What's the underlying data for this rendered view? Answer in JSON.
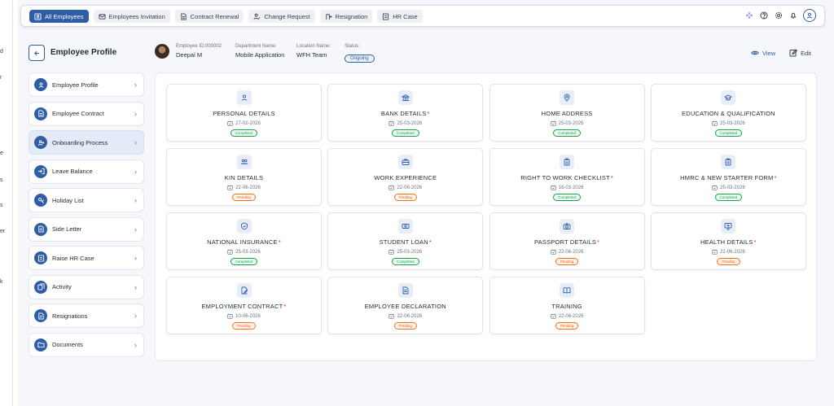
{
  "tabs": [
    {
      "label": "All Employees",
      "icon": "user-card-icon",
      "active": true
    },
    {
      "label": "Employees Invitation",
      "icon": "mail-icon",
      "active": false
    },
    {
      "label": "Contract Renewal",
      "icon": "document-icon",
      "active": false
    },
    {
      "label": "Change Request",
      "icon": "user-edit-icon",
      "active": false
    },
    {
      "label": "Resignation",
      "icon": "resign-icon",
      "active": false
    },
    {
      "label": "HR Case",
      "icon": "case-icon",
      "active": false
    }
  ],
  "edge_letters": [
    "d",
    "r",
    "e",
    "s",
    "s",
    "er",
    "k"
  ],
  "header": {
    "title": "Employee Profile",
    "employee_id_label": "Employee ID:000002",
    "employee_name": "Deepal M",
    "department_label": "Department Name:",
    "department_value": "Mobile Application",
    "location_label": "Location Name:",
    "location_value": "WFH Team",
    "status_label": "Status:",
    "status_value": "Ongoing",
    "view_label": "View",
    "edit_label": "Edit"
  },
  "menu": [
    {
      "label": "Employee Profile",
      "icon": "user-icon",
      "active": false
    },
    {
      "label": "Employee Contract",
      "icon": "document-icon",
      "active": false
    },
    {
      "label": "Onboarding Process",
      "icon": "user-plus-icon",
      "active": true
    },
    {
      "label": "Leave Balance",
      "icon": "leave-icon",
      "active": false
    },
    {
      "label": "Holiday List",
      "icon": "holiday-icon",
      "active": false
    },
    {
      "label": "Side Letter",
      "icon": "letter-icon",
      "active": false
    },
    {
      "label": "Raise HR Case",
      "icon": "case-icon",
      "active": false
    },
    {
      "label": "Activity",
      "icon": "activity-icon",
      "active": false
    },
    {
      "label": "Resignations",
      "icon": "resign-icon",
      "active": false
    },
    {
      "label": "Documents",
      "icon": "folder-icon",
      "active": false
    }
  ],
  "cards": [
    {
      "title": "PERSONAL DETAILS",
      "required": false,
      "date": "27-02-2026",
      "status": "Completed",
      "icon": "person-icon"
    },
    {
      "title": "BANK DETAILS",
      "required": true,
      "date": "25-03-2026",
      "status": "Completed",
      "icon": "bank-icon"
    },
    {
      "title": "HOME ADDRESS",
      "required": false,
      "date": "25-03-2026",
      "status": "Completed",
      "icon": "location-icon"
    },
    {
      "title": "EDUCATION & QUALIFICATION",
      "required": false,
      "date": "25-03-2026",
      "status": "Completed",
      "icon": "graduation-icon"
    },
    {
      "title": "KIN DETAILS",
      "required": false,
      "date": "22-06-2026",
      "status": "Pending",
      "icon": "people-icon"
    },
    {
      "title": "WORK EXPERIENCE",
      "required": false,
      "date": "22-06-2026",
      "status": "Pending",
      "icon": "briefcase-icon"
    },
    {
      "title": "RIGHT TO WORK CHECKLIST",
      "required": true,
      "date": "16-03-2026",
      "status": "Completed",
      "icon": "clipboard-icon"
    },
    {
      "title": "HMRC & NEW STARTER FORM",
      "required": true,
      "date": "25-03-2026",
      "status": "Completed",
      "icon": "clipboard-icon"
    },
    {
      "title": "NATIONAL INSURANCE",
      "required": true,
      "date": "25-03-2026",
      "status": "Completed",
      "icon": "shield-icon"
    },
    {
      "title": "STUDENT LOAN",
      "required": true,
      "date": "25-03-2026",
      "status": "Completed",
      "icon": "money-icon"
    },
    {
      "title": "PASSPORT DETAILS",
      "required": true,
      "date": "22-06-2026",
      "status": "Pending",
      "icon": "camera-icon"
    },
    {
      "title": "HEALTH DETAILS",
      "required": true,
      "date": "22-06-2026",
      "status": "Pending",
      "icon": "monitor-icon"
    },
    {
      "title": "EMPLOYMENT CONTRACT",
      "required": true,
      "date": "10-06-2026",
      "status": "Pending",
      "icon": "contract-edit-icon"
    },
    {
      "title": "EMPLOYEE DECLARATION",
      "required": false,
      "date": "22-06-2026",
      "status": "Pending",
      "icon": "declaration-icon"
    },
    {
      "title": "TRAINING",
      "required": false,
      "date": "22-06-2026",
      "status": "Pending",
      "icon": "book-icon"
    }
  ],
  "colors": {
    "primary": "#2f5ea6",
    "completed": "#16a34a",
    "pending": "#f97316",
    "required": "#dc2626"
  }
}
